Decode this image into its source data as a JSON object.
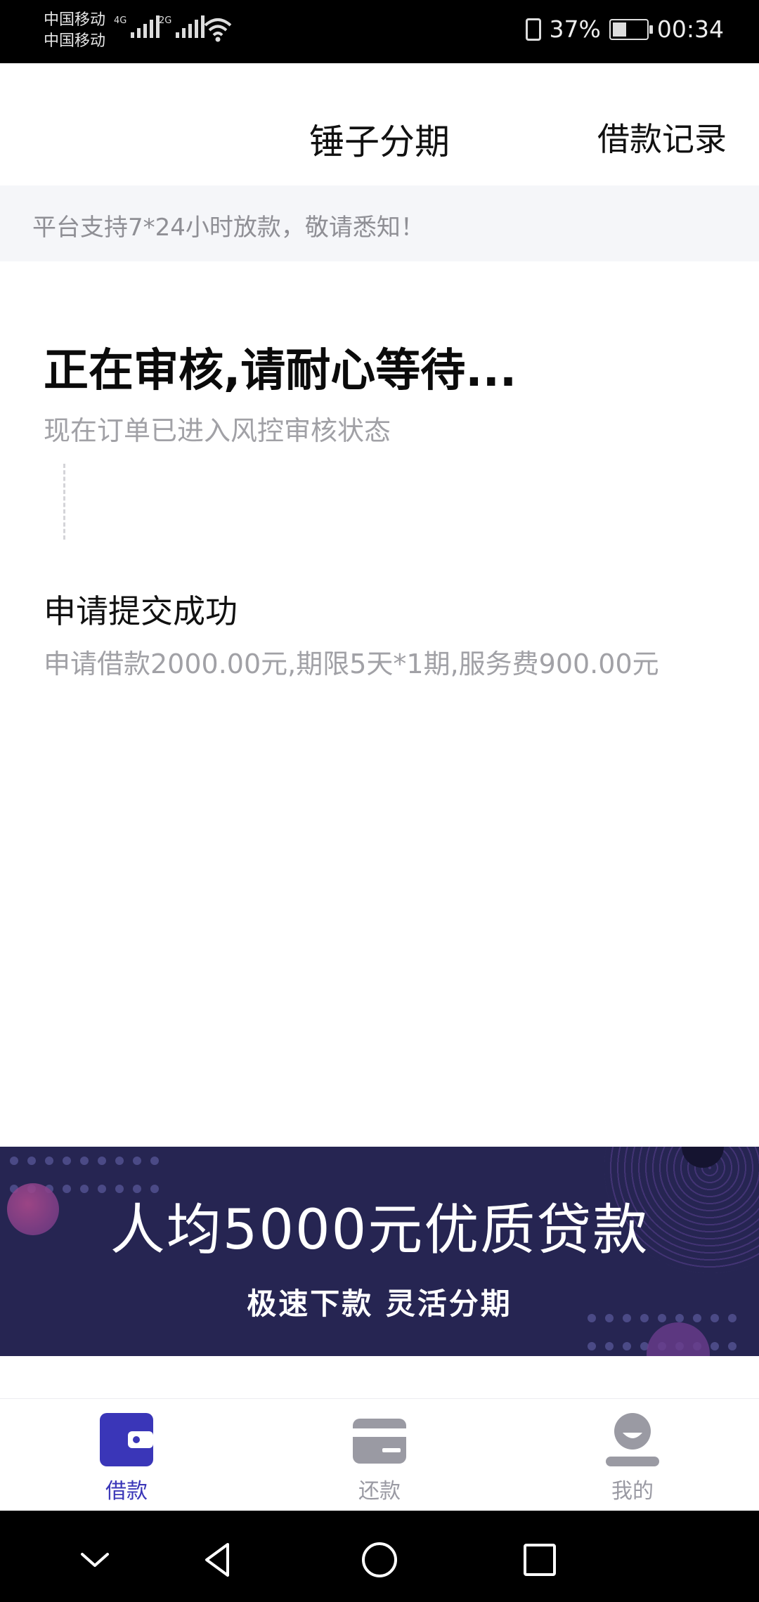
{
  "status_bar": {
    "carrier_1": "中国移动",
    "carrier_2": "中国移动",
    "net_1": "4G",
    "net_2": "2G",
    "battery": "37%",
    "time": "00:34"
  },
  "header": {
    "title": "锤子分期",
    "records": "借款记录"
  },
  "notice": "平台支持7*24小时放款，敬请悉知！",
  "review": {
    "title": "正在审核,请耐心等待...",
    "subtitle": "现在订单已进入风控审核状态"
  },
  "submit": {
    "title": "申请提交成功",
    "detail": "申请借款2000.00元,期限5天*1期,服务费900.00元"
  },
  "banner": {
    "headline": "人均5000元优质贷款",
    "tagline": "极速下款 灵活分期"
  },
  "tabs": [
    {
      "label": "借款",
      "icon": "wallet-icon",
      "active": true
    },
    {
      "label": "还款",
      "icon": "card-icon",
      "active": false
    },
    {
      "label": "我的",
      "icon": "profile-icon",
      "active": false
    }
  ],
  "colors": {
    "accent": "#3a36b8",
    "inactive": "#9a9aa3",
    "banner_bg": "#262552"
  }
}
